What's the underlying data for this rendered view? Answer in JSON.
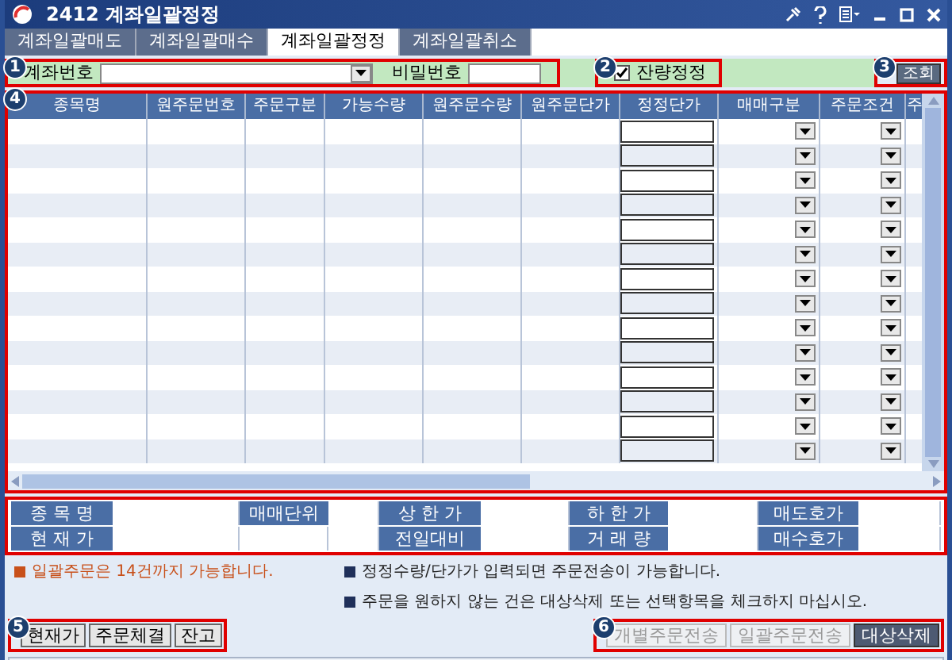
{
  "window": {
    "title": "2412 계좌일괄정정"
  },
  "tabs": [
    {
      "label": "계좌일괄매도",
      "selected": false
    },
    {
      "label": "계좌일괄매수",
      "selected": false
    },
    {
      "label": "계좌일괄정정",
      "selected": true
    },
    {
      "label": "계좌일괄취소",
      "selected": false
    }
  ],
  "query_bar": {
    "marker": "1",
    "account_label": "계좌번호",
    "password_label": "비밀번호",
    "remain_marker": "2",
    "remain_checkbox": {
      "label": "잔량정정",
      "checked": true
    },
    "search_marker": "3",
    "search_button": "조회"
  },
  "table": {
    "marker": "4",
    "columns": [
      "종목명",
      "원주문번호",
      "주문구분",
      "가능수량",
      "원주문수량",
      "원주문단가",
      "정정단가",
      "매매구분",
      "주문조건",
      "주"
    ],
    "rows": [
      {
        "kind": "order"
      },
      {
        "kind": "order"
      },
      {
        "kind": "order"
      },
      {
        "kind": "order"
      },
      {
        "kind": "order"
      },
      {
        "kind": "order"
      },
      {
        "kind": "order"
      },
      {
        "kind": "order"
      },
      {
        "kind": "order"
      },
      {
        "kind": "order"
      },
      {
        "kind": "order"
      },
      {
        "kind": "order"
      },
      {
        "kind": "order"
      },
      {
        "kind": "order"
      }
    ]
  },
  "info_grid": [
    [
      {
        "kind": "label",
        "text": "종 목 명"
      },
      {
        "kind": "value"
      },
      {
        "kind": "label",
        "text": "매매단위"
      },
      {
        "kind": "value"
      },
      {
        "kind": "label",
        "text": "상 한 가"
      },
      {
        "kind": "value"
      },
      {
        "kind": "label",
        "text": "하 한 가"
      },
      {
        "kind": "value"
      },
      {
        "kind": "label",
        "text": "매도호가"
      },
      {
        "kind": "value"
      }
    ],
    [
      {
        "kind": "label",
        "text": "현 재 가"
      },
      {
        "kind": "value"
      },
      {
        "kind": "value"
      },
      {
        "kind": "value"
      },
      {
        "kind": "label",
        "text": "전일대비"
      },
      {
        "kind": "value"
      },
      {
        "kind": "label",
        "text": "거 래 량"
      },
      {
        "kind": "value"
      },
      {
        "kind": "label",
        "text": "매수호가"
      },
      {
        "kind": "value"
      }
    ]
  ],
  "notes": [
    {
      "text": "일괄주문은 14건까지 가능합니다.",
      "color": "#c8501a"
    },
    {
      "text": "정정수량/단가가 입력되면 주문전송이 가능합니다.",
      "color": "#1f2f5a"
    },
    {
      "text": "주문을 원하지 않는 건은 대상삭제 또는 선택항목을 체크하지 마십시오.",
      "color": "#1f2f5a"
    }
  ],
  "left_buttons": {
    "marker": "5",
    "buttons": [
      "현재가",
      "주문체결",
      "잔고"
    ]
  },
  "right_buttons": {
    "marker": "6",
    "buttons": [
      {
        "label": "개별주문전송",
        "disabled": true
      },
      {
        "label": "일괄주문전송",
        "disabled": true
      },
      {
        "label": "대상삭제",
        "disabled": false
      }
    ]
  }
}
